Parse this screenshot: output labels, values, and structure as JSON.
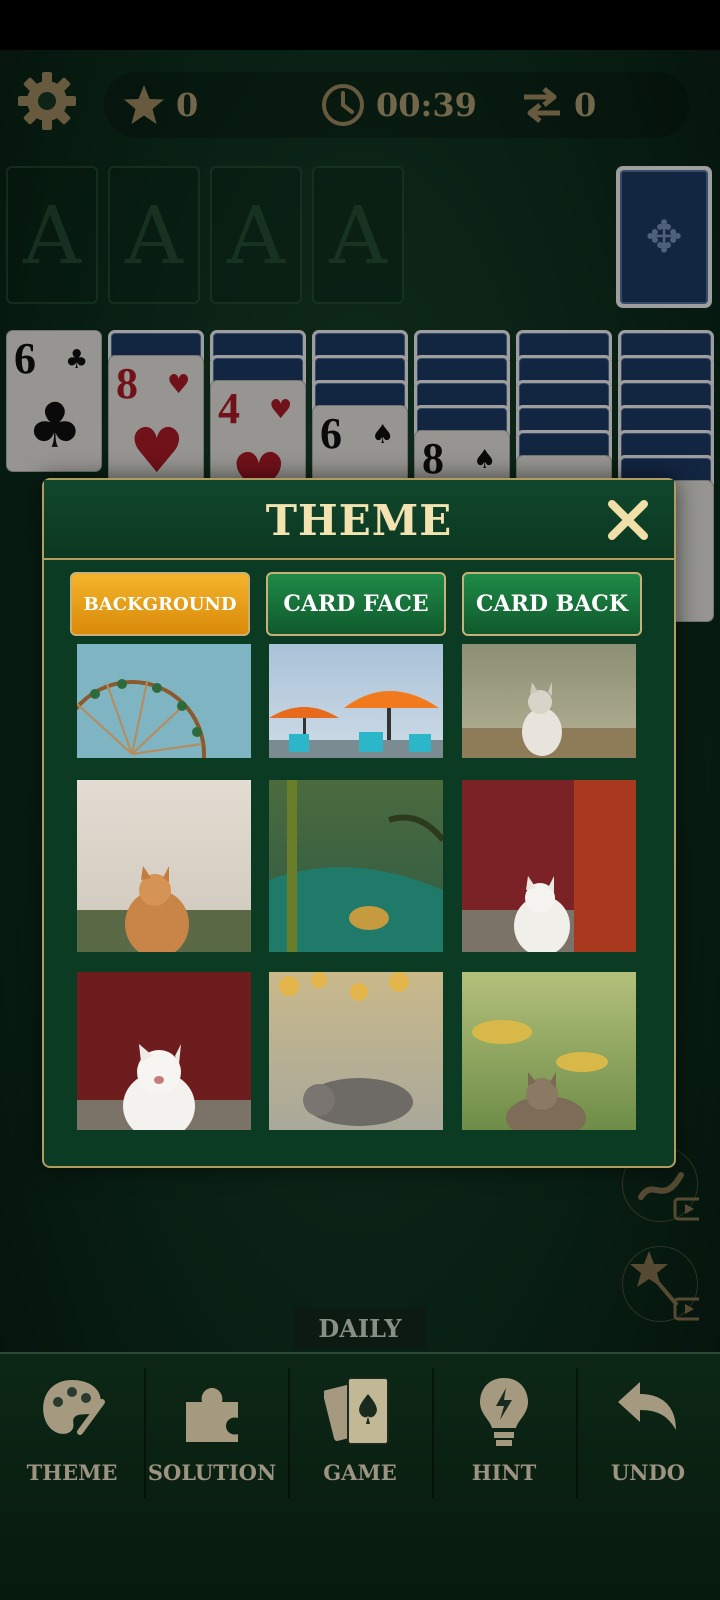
{
  "hud": {
    "stars": "0",
    "timer": "00:39",
    "moves": "0"
  },
  "foundations": [
    "A",
    "A",
    "A",
    "A"
  ],
  "tableau_top": [
    {
      "rank": "6",
      "suit": "♣",
      "color": "blk"
    },
    {
      "rank": "8",
      "suit": "♥",
      "color": "red"
    },
    {
      "rank": "4",
      "suit": "♥",
      "color": "red"
    },
    {
      "rank": "6",
      "suit": "♠",
      "color": "blk"
    },
    {
      "rank": "8",
      "suit": "♠",
      "color": "blk"
    }
  ],
  "modal": {
    "title": "THEME",
    "tabs": [
      "BACKGROUND",
      "CARD FACE",
      "CARD BACK"
    ],
    "active_tab": "BACKGROUND",
    "thumbnails": [
      "ferris-wheel",
      "beach-umbrellas",
      "cat-in-field",
      "orange-cat",
      "green-forest",
      "white-cat-red-wall",
      "white-cat-red-bg",
      "grey-cat-autumn",
      "tabby-cat-grass"
    ]
  },
  "daily_label": "DAILY",
  "nav": [
    {
      "label": "THEME",
      "icon": "palette-icon"
    },
    {
      "label": "SOLUTION",
      "icon": "puzzle-icon"
    },
    {
      "label": "GAME",
      "icon": "cards-icon"
    },
    {
      "label": "HINT",
      "icon": "lightbulb-icon"
    },
    {
      "label": "UNDO",
      "icon": "undo-icon"
    }
  ],
  "colors": {
    "felt": "#0f3320",
    "gold": "#b39a5f",
    "active_tab": "#f4b42a",
    "inactive_tab": "#1f8a48"
  }
}
